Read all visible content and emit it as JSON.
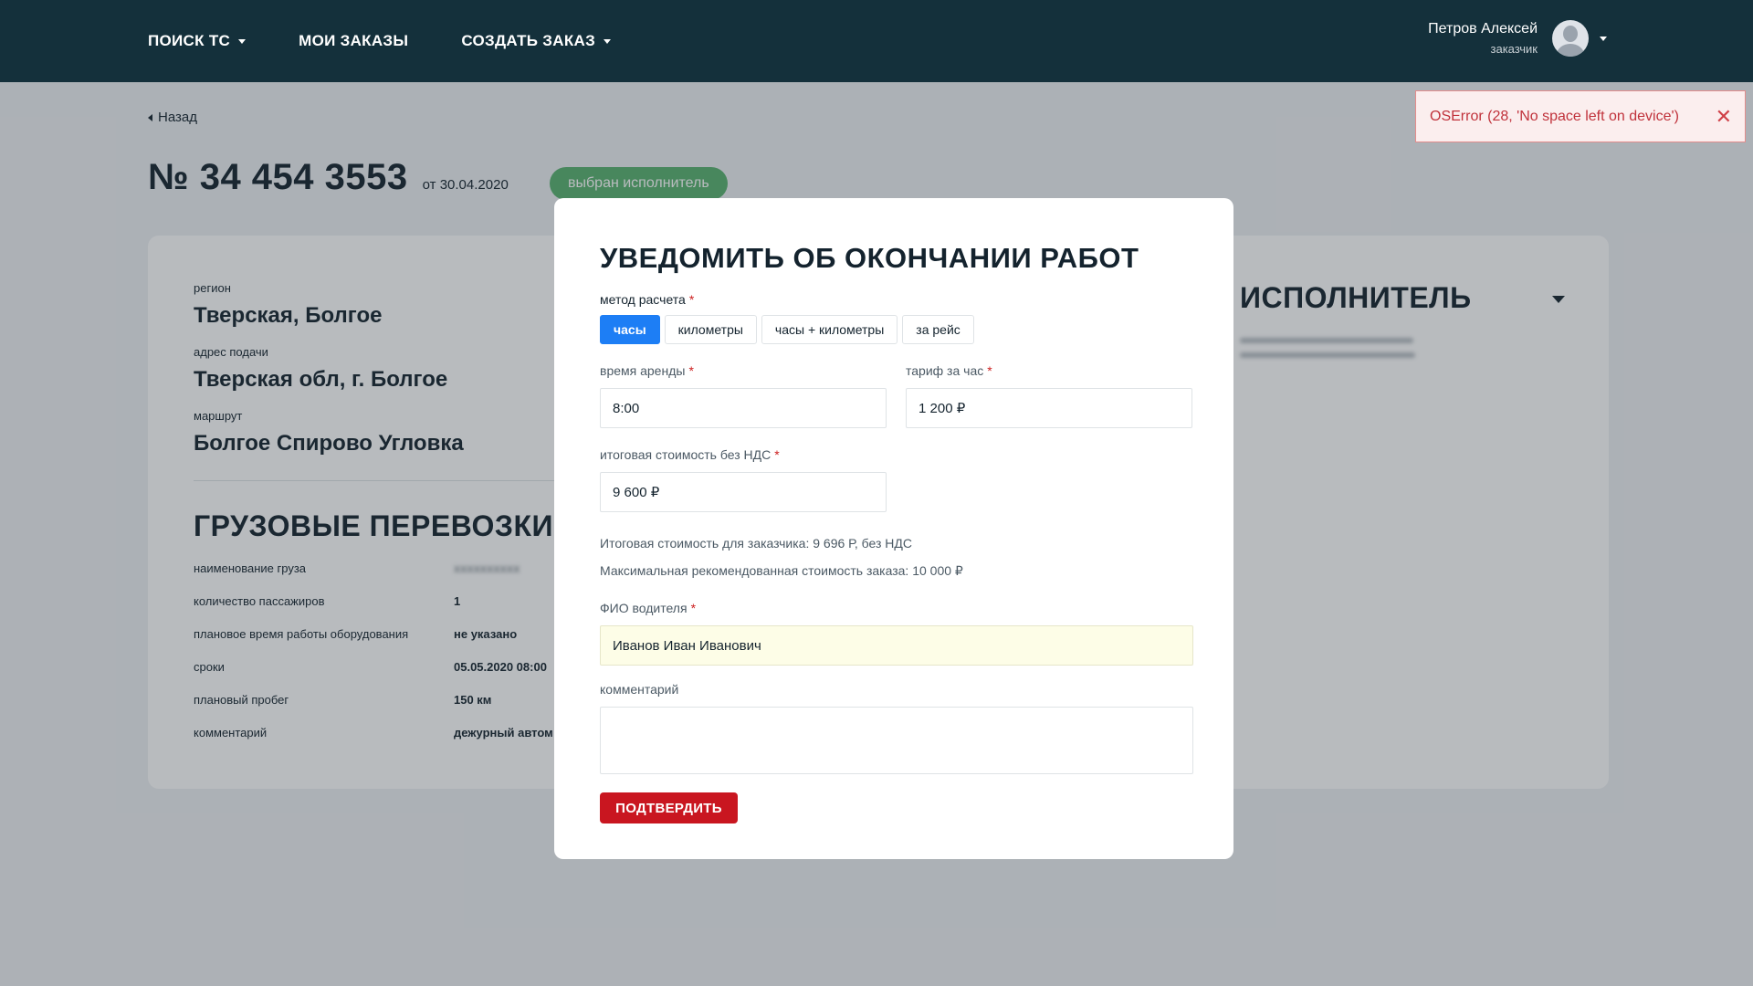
{
  "nav": {
    "search": "ПОИСК ТС",
    "my_orders": "МОИ ЗАКАЗЫ",
    "create_order": "СОЗДАТЬ ЗАКАЗ"
  },
  "user": {
    "name": "Петров Алексей",
    "role": "заказчик"
  },
  "toast": {
    "message": "OSError (28, 'No space left on device')",
    "close": "✕"
  },
  "page": {
    "back": "Назад",
    "order_number": "№ 34 454 3553",
    "order_date": "от 30.04.2020",
    "status": "выбран исполнитель"
  },
  "details": {
    "region_label": "регион",
    "region_value": "Тверская, Болгое",
    "address_label": "адрес подачи",
    "address_value": "Тверская обл, г. Болгое",
    "route_label": "маршрут",
    "route_value": "Болгое Спирово Угловка",
    "section_title": "ГРУЗОВЫЕ ПЕРЕВОЗКИ",
    "rows": [
      {
        "label": "наименование груза",
        "value": "xxxxxxxxxx"
      },
      {
        "label": "количество пассажиров",
        "value": "1"
      },
      {
        "label": "плановое время работы оборудования",
        "value": "не указано"
      },
      {
        "label": "сроки",
        "value": "05.05.2020 08:00"
      },
      {
        "label": "плановый пробег",
        "value": "150 км"
      },
      {
        "label": "комментарий",
        "value": "дежурный автом"
      }
    ],
    "executor_title": "ИСПОЛНИТЕЛЬ"
  },
  "modal": {
    "title": "УВЕДОМИТЬ ОБ ОКОНЧАНИИ РАБОТ",
    "method_label": "метод расчета",
    "methods": [
      "часы",
      "километры",
      "часы + километры",
      "за рейс"
    ],
    "active_method": "часы",
    "rent_time_label": "время аренды",
    "rent_time_value": "8:00",
    "tariff_label": "тариф за час",
    "tariff_value": "1 200 ₽",
    "total_label": "итоговая стоимость без НДС",
    "total_value": "9 600 ₽",
    "customer_total": "Итоговая стоимость для заказчика: 9 696 Р, без НДС",
    "max_recommended": "Максимальная рекомендованная стоимость заказа: 10 000 ₽",
    "driver_label": "ФИО водителя",
    "driver_value": "Иванов Иван Иванович",
    "comment_label": "комментарий",
    "comment_value": "",
    "required_mark": "*",
    "confirm": "ПОДТВЕРДИТЬ"
  },
  "colors": {
    "nav_bg": "#14303b",
    "primary_blue": "#1d7ef5",
    "confirm_red": "#c91620",
    "status_green": "#58b26f",
    "error_red": "#c0323b"
  }
}
